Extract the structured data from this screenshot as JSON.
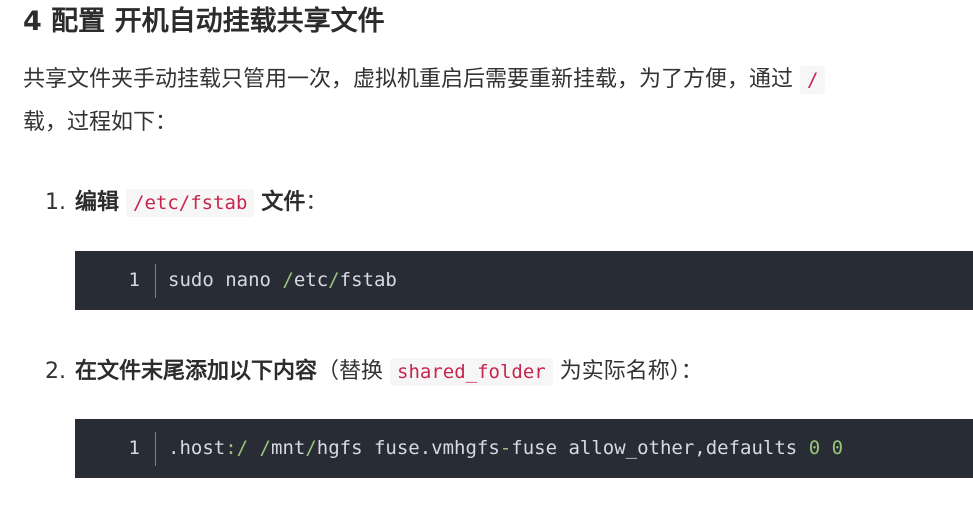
{
  "heading": "4 配置 开机自动挂载共享文件",
  "intro": {
    "line1": "共享文件夹手动挂载只管用一次，虚拟机重启后需要重新挂载，为了方便，通过",
    "line1_code": "/",
    "line2": "载，过程如下："
  },
  "steps": [
    {
      "number": "1.",
      "label_before": "编辑",
      "code": "/etc/fstab",
      "label_after": "文件",
      "suffix": "：",
      "block": {
        "line_number": "1",
        "tokens": [
          "sudo nano ",
          "/",
          "etc",
          "/",
          "fstab"
        ]
      }
    },
    {
      "number": "2.",
      "label_bold": "在文件末尾添加以下内容",
      "paren_open": "（替换",
      "code": "shared_folder",
      "paren_close": "为实际名称）：",
      "block": {
        "line_number": "1",
        "tokens": [
          ".host",
          ":/",
          " ",
          "/",
          "mnt",
          "/",
          "hgfs fuse.vmhgfs",
          "-",
          "fuse allow_other,defaults ",
          "0",
          " ",
          "0"
        ]
      }
    }
  ],
  "colors": {
    "code_bg": "#282c34",
    "inline_code": "#c7254e",
    "operator": "#98c379"
  }
}
